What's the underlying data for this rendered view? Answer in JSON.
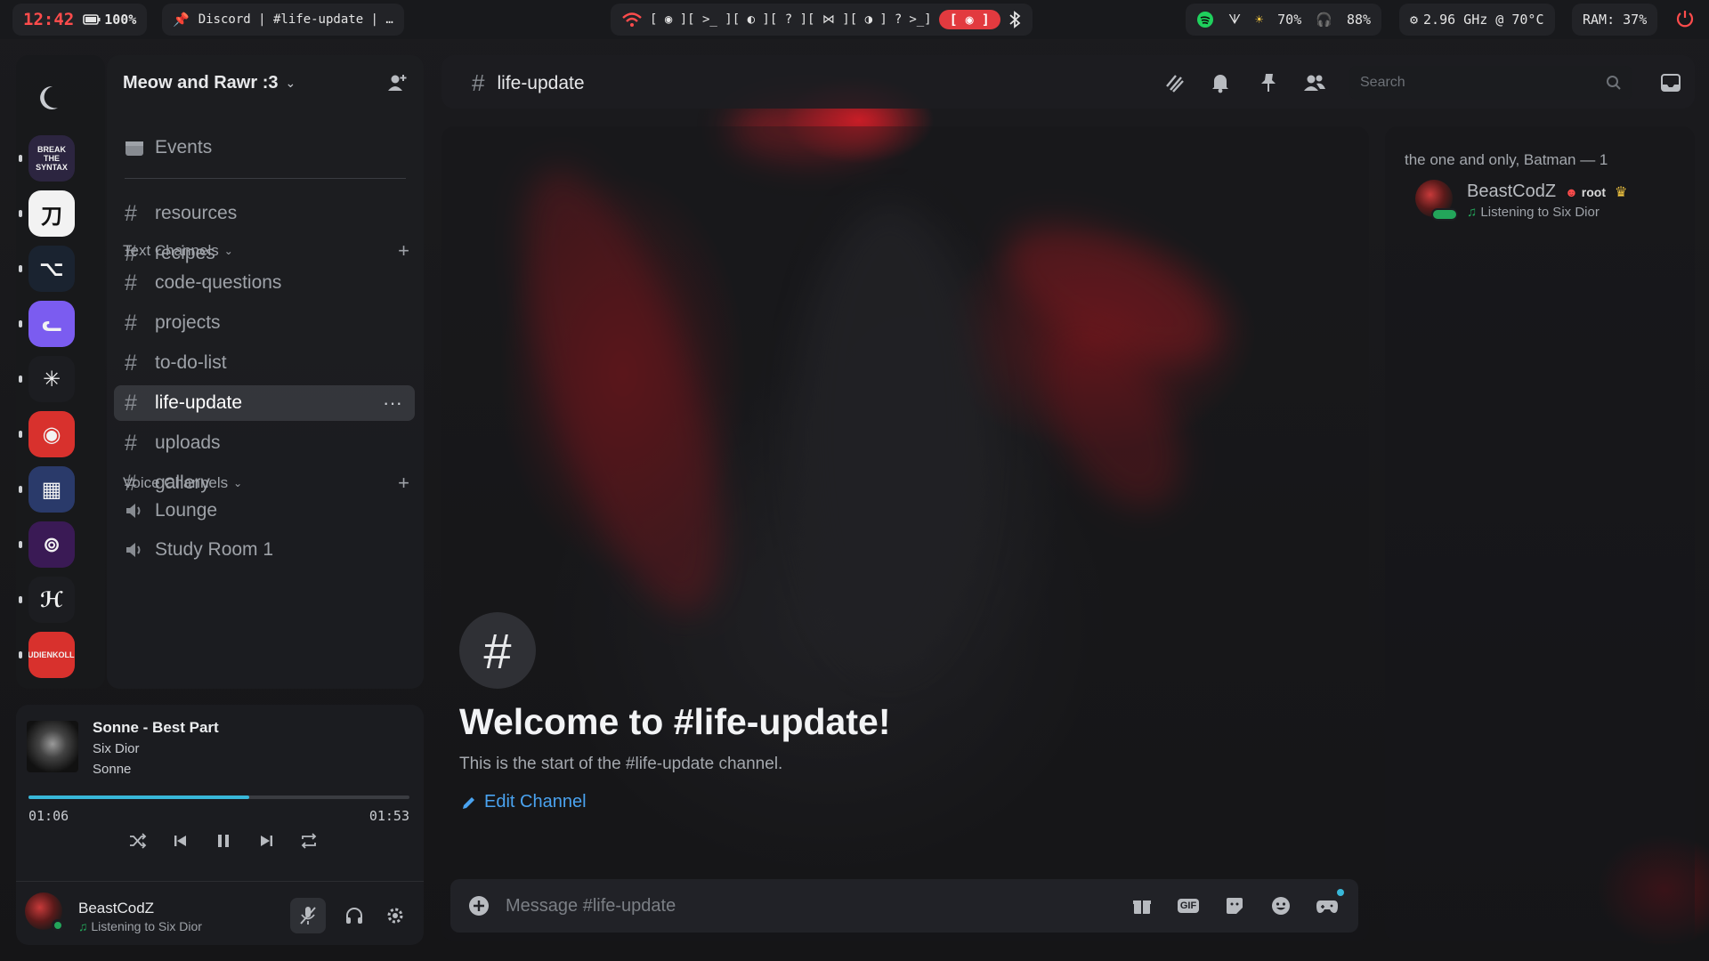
{
  "topbar": {
    "clock": "12:42",
    "battery": "100%",
    "window_title": "Discord | #life-update | …",
    "workspaces": "[ ◉ ][ >_ ][ ◐ ][ ? ][ ⋈ ][ ◑ ]",
    "workspace_extra": "?",
    "terminal_label": ">_]",
    "recording_label": "[ ◉ ]",
    "brightness": "70%",
    "headphones": "88%",
    "cpu": "2.96 GHz @ 70°C",
    "ram": "RAM: 37%"
  },
  "server": {
    "name": "Meow and Rawr :3",
    "events_label": "Events",
    "pinned_channels": [
      "resources",
      "recipes"
    ],
    "text_category": "Text Channels",
    "text_channels": [
      "code-questions",
      "projects",
      "to-do-list",
      "life-update",
      "uploads",
      "gallery"
    ],
    "voice_category": "Voice Channels",
    "voice_channels": [
      "Lounge",
      "Study Room 1"
    ],
    "server_icons": [
      {
        "label": "BREAK THE SYNTAX",
        "bg": "#2c2540"
      },
      {
        "label": "刀",
        "bg": "#f2f2f2"
      },
      {
        "label": "⌥",
        "bg": "#1a2330"
      },
      {
        "label": "ᓚ",
        "bg": "#7b5cf0"
      },
      {
        "label": "✳",
        "bg": "#1c1d21"
      },
      {
        "label": "◉",
        "bg": "#d8312d"
      },
      {
        "label": "▦",
        "bg": "#2a3a6a"
      },
      {
        "label": "⊚",
        "bg": "#3a1a55"
      },
      {
        "label": "ℋ",
        "bg": "#1c1d21"
      },
      {
        "label": "STUDIENKOLLEG",
        "bg": "#d8312d"
      }
    ]
  },
  "music": {
    "title": "Sonne - Best Part",
    "artist": "Six Dior",
    "album": "Sonne",
    "elapsed": "01:06",
    "total": "01:53",
    "progress": 0.58
  },
  "user": {
    "name": "BeastCodZ",
    "status": "Listening to Six Dior"
  },
  "header": {
    "channel": "life-update",
    "search_placeholder": "Search"
  },
  "chat": {
    "welcome_title": "Welcome to #life-update!",
    "welcome_sub": "This is the start of the #life-update channel.",
    "edit_label": "Edit Channel",
    "composer_placeholder": "Message #life-update",
    "gif_label": "GIF"
  },
  "members": {
    "category": "the one and only, Batman — 1",
    "name": "BeastCodZ",
    "role": "root",
    "status": "Listening to Six Dior"
  },
  "colors": {
    "accent_blue": "#4aa3f0",
    "online": "#23a55a",
    "recording": "#e23a3f",
    "progress": "#38b8d9"
  }
}
